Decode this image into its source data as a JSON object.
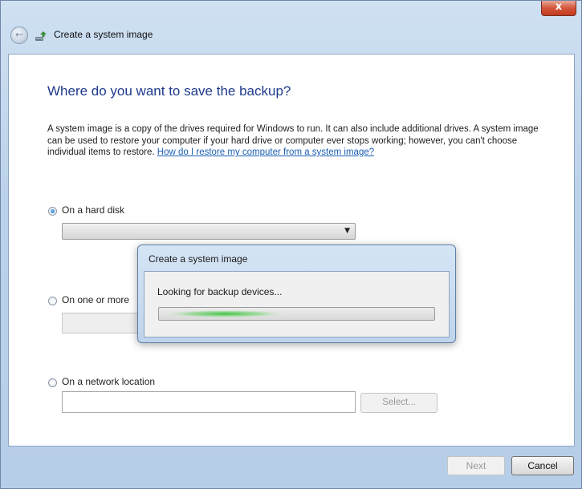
{
  "window": {
    "close_glyph": "x",
    "back_glyph": "←",
    "title": "Create a system image"
  },
  "main": {
    "heading": "Where do you want to save the backup?",
    "description": "A system image is a copy of the drives required for Windows to run. It can also include additional drives. A system image can be used to restore your computer if your hard drive or computer ever stops working; however, you can't choose individual items to restore. ",
    "help_link": "How do I restore my computer from a system image?"
  },
  "options": {
    "hard_disk": {
      "label": "On a hard disk",
      "selected": true,
      "dropdown_value": ""
    },
    "dvd": {
      "label": "On one or more",
      "selected": false
    },
    "network": {
      "label": "On a network location",
      "selected": false,
      "path_value": "",
      "select_button": "Select..."
    }
  },
  "popup": {
    "title": "Create a system image",
    "status": "Looking for backup devices...",
    "progress_style": "marquee"
  },
  "footer": {
    "next_label": "Next",
    "cancel_label": "Cancel"
  },
  "colors": {
    "heading": "#1f3a8c",
    "link": "#1a5fb4",
    "progress_glow": "#3cc23c",
    "close_button": "#c9452a"
  },
  "icons": {
    "close": "close-icon",
    "back": "back-arrow-icon",
    "app": "backup-icon",
    "dropdown": "chevron-down-icon"
  }
}
